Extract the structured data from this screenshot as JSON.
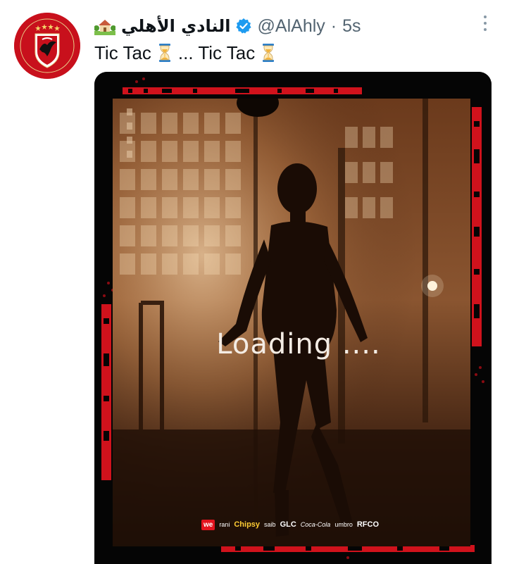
{
  "tweet": {
    "display_name": "النادي الأهلي",
    "handle": "@AlAhly",
    "separator": "·",
    "time": "5s",
    "text_part1": "Tic Tac",
    "text_part2": "... Tic Tac",
    "icons": {
      "avatar": "al-ahly-club-logo",
      "name_emoji": "house-with-garden-icon",
      "verified": "verified-badge-icon",
      "more": "more-options-icon",
      "hourglass": "hourglass-icon"
    }
  },
  "media": {
    "overlay_text": "Loading ....",
    "sponsors": [
      "we",
      "rani",
      "Chipsy",
      "saib",
      "GLC",
      "Coca-Cola",
      "umbro",
      "RFCO"
    ]
  },
  "colors": {
    "accent_red": "#c8101c",
    "verified_blue": "#1d9bf0",
    "text_primary": "#0f1419",
    "text_secondary": "#536471"
  }
}
